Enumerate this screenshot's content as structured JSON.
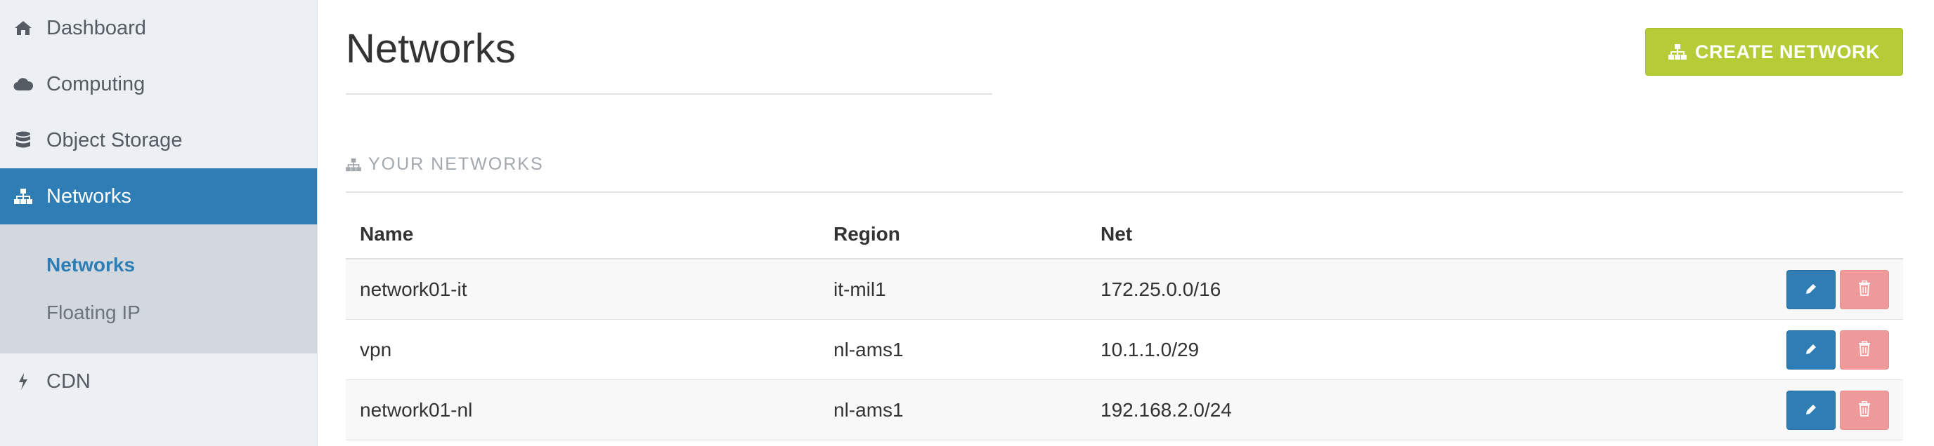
{
  "sidebar": {
    "items": [
      {
        "label": "Dashboard",
        "icon": "home-icon"
      },
      {
        "label": "Computing",
        "icon": "cloud-icon"
      },
      {
        "label": "Object Storage",
        "icon": "database-icon"
      },
      {
        "label": "Networks",
        "icon": "sitemap-icon",
        "active": true
      },
      {
        "label": "CDN",
        "icon": "bolt-icon"
      }
    ],
    "subitems": [
      {
        "label": "Networks",
        "active": true
      },
      {
        "label": "Floating IP"
      }
    ]
  },
  "main": {
    "title": "Networks",
    "create_button": "CREATE NETWORK",
    "section_title": "YOUR NETWORKS",
    "columns": {
      "name": "Name",
      "region": "Region",
      "net": "Net"
    },
    "rows": [
      {
        "name": "network01-it",
        "region": "it-mil1",
        "net": "172.25.0.0/16"
      },
      {
        "name": "vpn",
        "region": "nl-ams1",
        "net": "10.1.1.0/29"
      },
      {
        "name": "network01-nl",
        "region": "nl-ams1",
        "net": "192.168.2.0/24"
      }
    ]
  },
  "colors": {
    "accent_blue": "#2e7db5",
    "create_green": "#b5cc36",
    "delete_red": "#ef9a9a",
    "sidebar_bg": "#eceff3"
  }
}
